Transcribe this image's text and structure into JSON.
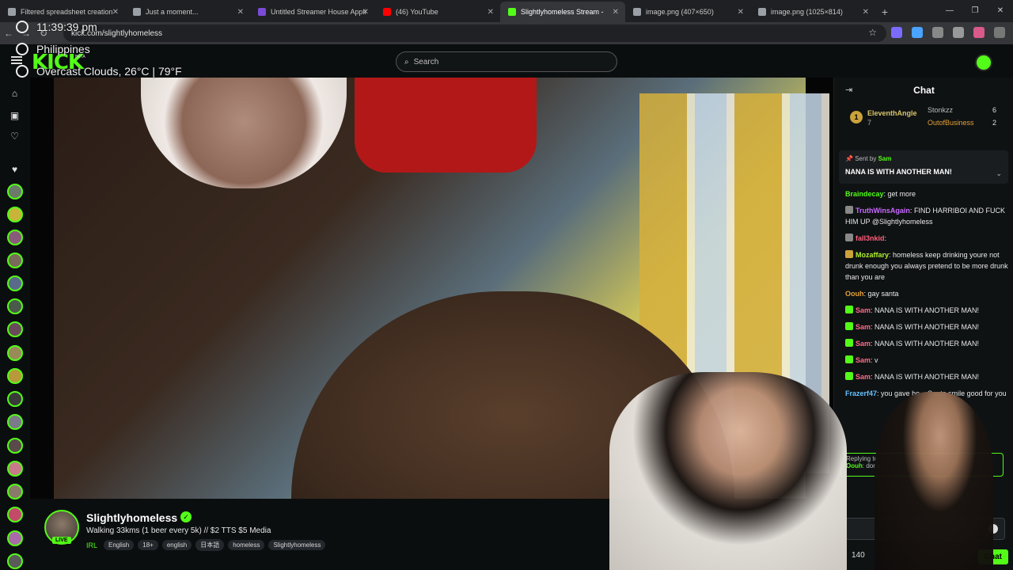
{
  "browser": {
    "tabs": [
      {
        "label": "Filtered spreadsheet creation",
        "color": "#9aa0a6"
      },
      {
        "label": "Just a moment...",
        "color": "#9aa0a6"
      },
      {
        "label": "Untitled Streamer House Appli",
        "color": "#7a4ad8"
      },
      {
        "label": "(46) YouTube",
        "color": "#ff0000"
      },
      {
        "label": "Slightlyhomeless Stream -",
        "color": "#53fc18",
        "active": true
      },
      {
        "label": "image.png (407×650)",
        "color": "#9aa0a6"
      },
      {
        "label": "image.png (1025×814)",
        "color": "#9aa0a6"
      }
    ],
    "url": "kick.com/slightlyhomeless"
  },
  "overlay": {
    "time": "11:39:39 pm",
    "location": "Philippines",
    "weather": "Overcast Clouds, 26°C | 79°F"
  },
  "header": {
    "logo": "KICK",
    "beta": "BETA",
    "search_placeholder": "Search"
  },
  "stream": {
    "name": "Slightlyhomeless",
    "live": "LIVE",
    "title": "Walking 33kms (1 beer every 5k) //  $2 TTS $5 Media",
    "category": "IRL",
    "tags": [
      "English",
      "18+",
      "english",
      "日本語",
      "homeless",
      "Slightlyhomeless"
    ]
  },
  "chat": {
    "title": "Chat",
    "leaderboard": {
      "first": {
        "rank": "1",
        "name": "EleventhAngle",
        "count": "7"
      },
      "second": {
        "name": "Stonkzz",
        "count": "6"
      },
      "third": {
        "name": "OutofBusiness",
        "count": "2"
      }
    },
    "pinned": {
      "sent_by_label": "Sent by",
      "sender": "Sam",
      "message": "NANA IS WITH ANOTHER MAN!"
    },
    "messages": [
      {
        "user": "Braindecay",
        "color": "#53fc18",
        "text": "get more"
      },
      {
        "user": "TruthWinsAgain",
        "color": "#c86aff",
        "text": "FIND HARRIBOI AND FUCK HIM UP @Slightlyhomeless"
      },
      {
        "user": "fall3nkid",
        "color": "#ff5e7a",
        "text": ""
      },
      {
        "user": "Mozaffary",
        "color": "#b0f030",
        "text": "homeless keep drinking youre not drunk enough you always pretend to be more drunk than you are"
      },
      {
        "user": "Oouh",
        "color": "#e6a23a",
        "text": "gay santa"
      },
      {
        "user": "Sam",
        "color": "#ff6a8a",
        "text": "NANA IS WITH ANOTHER MAN!"
      },
      {
        "user": "Sam",
        "color": "#ff6a8a",
        "text": "NANA IS WITH ANOTHER MAN!"
      },
      {
        "user": "Sam",
        "color": "#ff6a8a",
        "text": "NANA IS WITH ANOTHER MAN!"
      },
      {
        "user": "Sam",
        "color": "#ff6a8a",
        "text": "v"
      },
      {
        "user": "Sam",
        "color": "#ff6a8a",
        "text": "NANA IS WITH ANOTHER MAN!"
      },
      {
        "user": "Frazerf47",
        "color": "#66c2ff",
        "text": "you gave ho... Santa smile good for you"
      }
    ],
    "reply": {
      "label": "Replying to",
      "user": "Oouh",
      "text": "dona..."
    },
    "points": "140",
    "send_label": "Chat"
  }
}
